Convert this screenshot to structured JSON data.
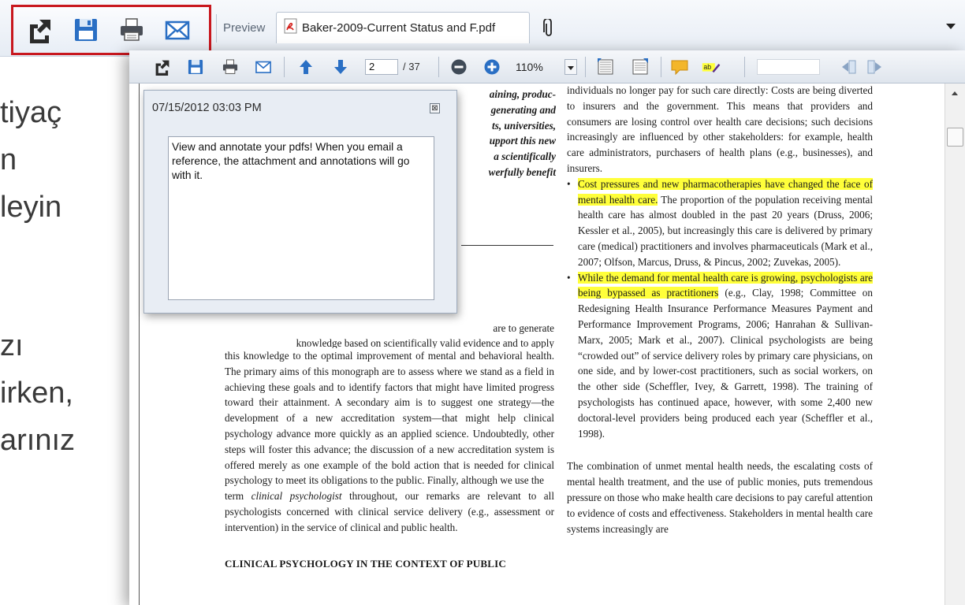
{
  "slide": {
    "lines": [
      "tiyaç",
      "n",
      "leyin",
      "zı",
      "irken,",
      "arınız"
    ]
  },
  "topbar": {
    "preview_label": "Preview",
    "doc_tab_label": "Baker-2009-Current Status and F.pdf"
  },
  "toolbar": {
    "page_number": "2",
    "page_total": "/ 37",
    "zoom": "110%"
  },
  "note": {
    "timestamp": "07/15/2012 03:03 PM",
    "close_glyph": "⊠",
    "text": "View and annotate your pdfs! When you email a reference, the attachment and annotations will go with it."
  },
  "document": {
    "left_top_lines": [
      "aining, produc-",
      "generating and",
      "ts, universities,",
      "upport this new",
      "a scientifically",
      "werfully benefit"
    ],
    "left_are_to_generate": "are to generate",
    "left_cut_line": "knowledge based on scientifically valid evidence and to apply",
    "left_para": "this knowledge to the optimal improvement of mental and behavioral health. The primary aims of this monograph are to assess where we stand as a field in achieving these goals and to identify factors that might have limited progress toward their attainment. A secondary aim is to suggest one strategy—the development of a new accreditation system—that might help clinical psychology advance more quickly as an applied science. Undoubtedly, other steps will foster this advance; the discussion of a new accreditation system is offered merely as one example of the bold action that is needed for clinical psychology to meet its obligations to the public. Finally, although we use the",
    "left_term_pre": "term ",
    "left_term_italic": "clinical psychologist",
    "left_term_post": " throughout, our remarks are relevant to all psychologists concerned with clinical service delivery (e.g., assessment or intervention) in the service of clinical and public health.",
    "left_heading": "CLINICAL PSYCHOLOGY IN THE CONTEXT OF PUBLIC",
    "right_para1": "individuals no longer pay for such care directly: Costs are being diverted to insurers and the government. This means that providers and consumers are losing control over health care decisions; such decisions increasingly are influenced by other stakeholders: for example, health care administrators, purchasers of health plans (e.g., businesses), and insurers.",
    "bullet_glyph": "•",
    "bullet1_highlight": "Cost pressures and new pharmacotherapies have changed the face of mental health care.",
    "bullet1_rest": " The proportion of the population receiving mental health care has almost doubled in the past 20 years (Druss, 2006; Kessler et al., 2005), but increasingly this care is delivered by primary care (medical) practitioners and involves pharmaceuticals (Mark et al., 2007; Olfson, Marcus, Druss, & Pincus, 2002; Zuvekas, 2005).",
    "bullet2_highlight": "While the demand for mental health care is growing, psychologists are being bypassed as practitioners",
    "bullet2_rest": " (e.g., Clay, 1998; Committee on Redesigning Health Insurance Performance Measures Payment and Performance Improvement Programs, 2006; Hanrahan & Sullivan-Marx, 2005; Mark et al., 2007). Clinical psychologists are being “crowded out” of service delivery roles by primary care physicians, on one side, and by lower-cost practitioners, such as social workers, on the other side (Scheffler, Ivey, & Garrett, 1998). The training of psychologists has continued apace, however, with some 2,400 new doctoral-level providers being produced each year (Scheffler et al., 1998).",
    "right_para2": "The combination of unmet mental health needs, the escalating costs of mental health treatment, and the use of public monies, puts tremendous pressure on those who make health care decisions to pay careful attention to evidence of costs and effectiveness. Stakeholders in mental health care systems increasingly are"
  },
  "colors": {
    "highlight": "#ffff3a",
    "callout_border": "#c8171e",
    "accent_blue": "#2a6fc4"
  }
}
